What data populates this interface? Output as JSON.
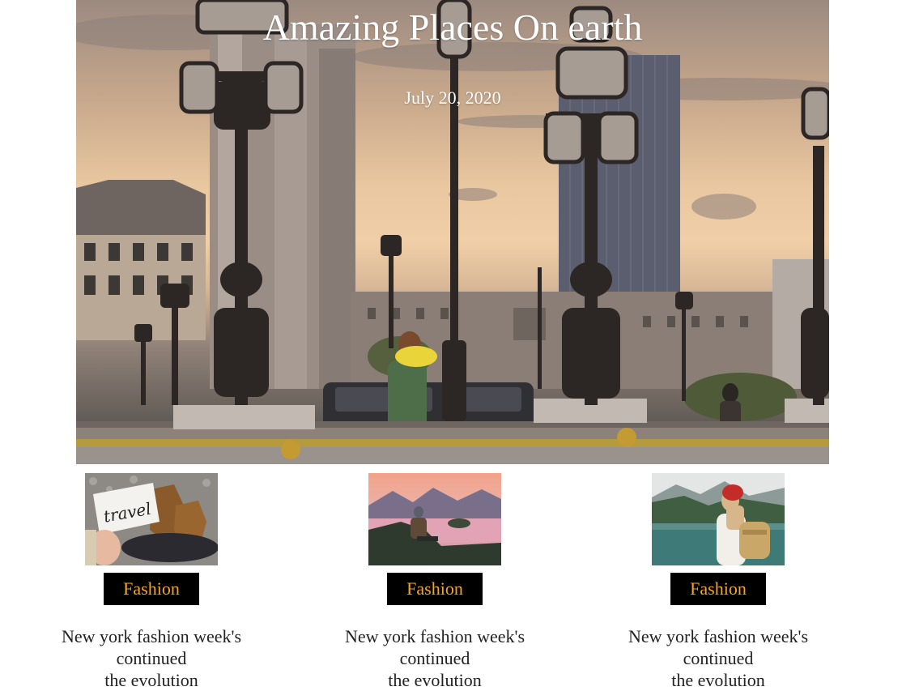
{
  "hero": {
    "title": "Amazing Places On earth",
    "date": "July 20, 2020",
    "image": "paris-bridge-lamps-photo"
  },
  "colors": {
    "tag_background": "#000000",
    "tag_text": "#f5a623",
    "title_text": "#ffffff",
    "caption_text": "#222222"
  },
  "cards": [
    {
      "image": "travel-sign-boots-photo",
      "tag": "Fashion",
      "caption_line1": "New york fashion week's",
      "caption_line2": "continued",
      "caption_line3": "the evolution"
    },
    {
      "image": "mountain-lake-hiker-photo",
      "tag": "Fashion",
      "caption_line1": "New york fashion week's",
      "caption_line2": "continued",
      "caption_line3": "the evolution"
    },
    {
      "image": "woman-red-hat-lake-photo",
      "tag": "Fashion",
      "caption_line1": "New york fashion week's",
      "caption_line2": "continued",
      "caption_line3": "the evolution"
    }
  ]
}
